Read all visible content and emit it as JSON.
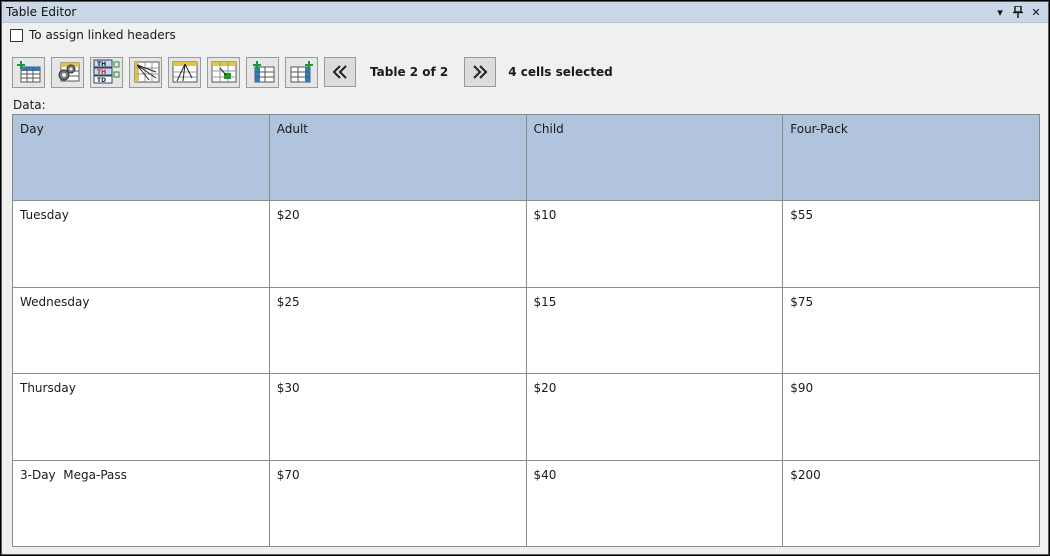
{
  "window": {
    "title": "Table Editor"
  },
  "title_controls": {
    "dropdown": "▾",
    "pin": "🖈",
    "close": "✕"
  },
  "checkbox": {
    "label": "To assign linked headers",
    "checked": false
  },
  "toolbar": {
    "buttons": [
      {
        "name": "insert-table-icon"
      },
      {
        "name": "table-settings-icon"
      },
      {
        "name": "header-cells-icon"
      },
      {
        "name": "associate-headers-icon"
      },
      {
        "name": "link-headers-icon"
      },
      {
        "name": "select-cells-icon"
      },
      {
        "name": "insert-row-icon"
      },
      {
        "name": "insert-column-icon"
      }
    ],
    "prev": "«",
    "next": "»",
    "table_counter": "Table 2 of 2",
    "selection_status": "4 cells selected"
  },
  "data_label": "Data:",
  "table": {
    "headers": [
      "Day",
      "Adult",
      "Child",
      "Four-Pack"
    ],
    "rows": [
      [
        "Tuesday",
        "$20",
        "$10",
        "$55"
      ],
      [
        "Wednesday",
        "$25",
        "$15",
        "$75"
      ],
      [
        "Thursday",
        "$30",
        "$20",
        "$90"
      ],
      [
        "3-Day  Mega-Pass",
        "$70",
        "$40",
        "$200"
      ]
    ]
  },
  "colors": {
    "header_bg": "#b0c4de",
    "titlebar_bg": "#c9d7e7"
  }
}
